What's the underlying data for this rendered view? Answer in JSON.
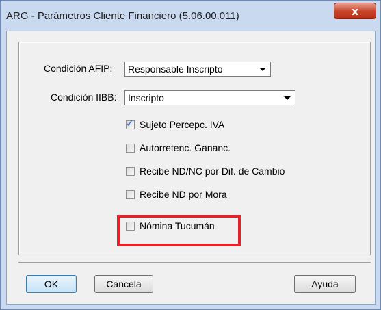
{
  "window": {
    "title": "ARG - Parámetros Cliente Financiero (5.06.00.011)",
    "close_symbol": "x"
  },
  "form": {
    "afip": {
      "label": "Condición AFIP:",
      "value": "Responsable Inscripto"
    },
    "iibb": {
      "label": "Condición IIBB:",
      "value": "Inscripto"
    },
    "checkboxes": [
      {
        "label": "Sujeto Percepc. IVA",
        "checked": true
      },
      {
        "label": "Autorretenc. Gananc.",
        "checked": false
      },
      {
        "label": "Recibe ND/NC por Dif. de Cambio",
        "checked": false
      },
      {
        "label": "Recibe ND por Mora",
        "checked": false
      },
      {
        "label": "Nómina Tucumán",
        "checked": false
      }
    ],
    "check_mark": "✓"
  },
  "buttons": {
    "ok": "OK",
    "cancel": "Cancela",
    "help": "Ayuda"
  },
  "colors": {
    "highlight": "#e3222b",
    "close_button": "#c9452b"
  }
}
